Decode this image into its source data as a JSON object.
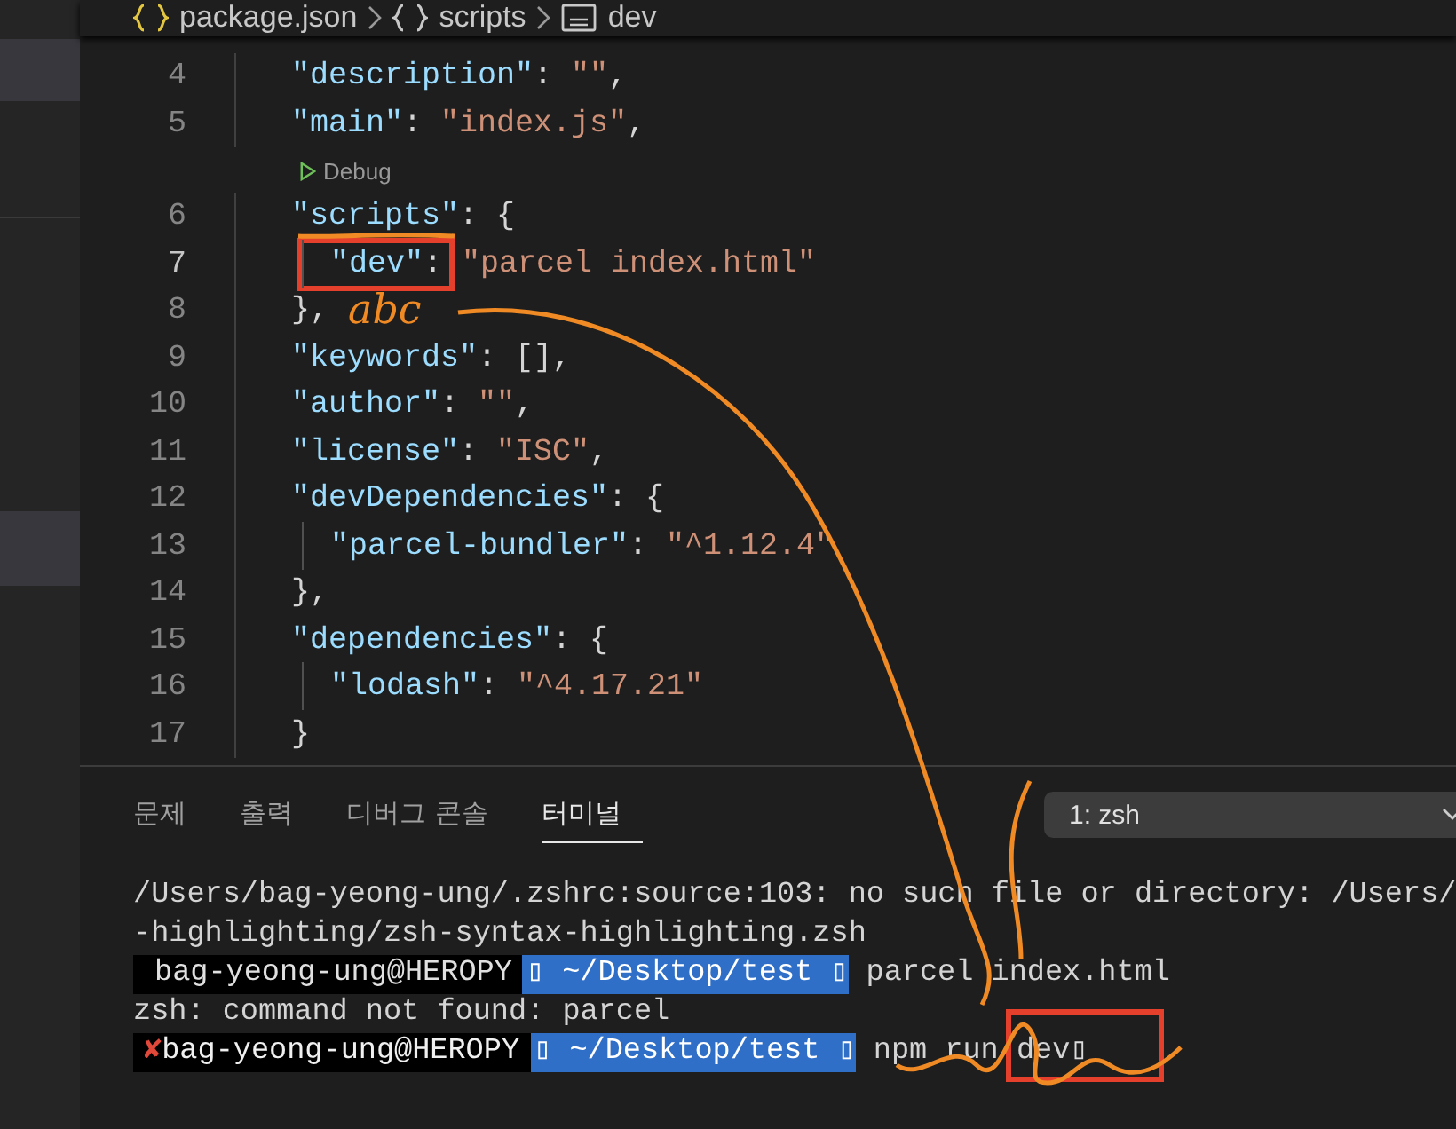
{
  "breadcrumb": [
    {
      "kind": "object",
      "label": "package.json"
    },
    {
      "kind": "object",
      "label": "scripts"
    },
    {
      "kind": "string",
      "label": "dev"
    }
  ],
  "editor": {
    "lines": [
      {
        "number": "4",
        "current": false,
        "tokens": [
          {
            "kind": "key",
            "text": "\"description\""
          },
          {
            "kind": "punct",
            "text": ": "
          },
          {
            "kind": "string",
            "text": "\"\""
          },
          {
            "kind": "punct",
            "text": ","
          }
        ]
      },
      {
        "number": "5",
        "current": false,
        "tokens": [
          {
            "kind": "key",
            "text": "\"main\""
          },
          {
            "kind": "punct",
            "text": ": "
          },
          {
            "kind": "string",
            "text": "\"index.js\""
          },
          {
            "kind": "punct",
            "text": ","
          }
        ],
        "codelens": "Debug"
      },
      {
        "number": "6",
        "current": false,
        "tokens": [
          {
            "kind": "key",
            "text": "\"scripts\""
          },
          {
            "kind": "punct",
            "text": ": {"
          }
        ],
        "children": [
          {
            "number": "7",
            "current": true,
            "tokens": [
              {
                "kind": "key",
                "text": "\"dev\"",
                "annotated": true
              },
              {
                "kind": "punct",
                "text": ":",
                "annotated": true
              },
              {
                "kind": "string",
                "text": "\"parcel index.html\""
              }
            ]
          }
        ]
      },
      {
        "number": "8",
        "current": false,
        "tokens": [
          {
            "kind": "punct",
            "text": "},"
          }
        ]
      },
      {
        "number": "9",
        "current": false,
        "tokens": [
          {
            "kind": "key",
            "text": "\"keywords\""
          },
          {
            "kind": "punct",
            "text": ": [],"
          }
        ]
      },
      {
        "number": "10",
        "current": false,
        "tokens": [
          {
            "kind": "key",
            "text": "\"author\""
          },
          {
            "kind": "punct",
            "text": ": "
          },
          {
            "kind": "string",
            "text": "\"\""
          },
          {
            "kind": "punct",
            "text": ","
          }
        ]
      },
      {
        "number": "11",
        "current": false,
        "tokens": [
          {
            "kind": "key",
            "text": "\"license\""
          },
          {
            "kind": "punct",
            "text": ": "
          },
          {
            "kind": "string",
            "text": "\"ISC\""
          },
          {
            "kind": "punct",
            "text": ","
          }
        ]
      },
      {
        "number": "12",
        "current": false,
        "tokens": [
          {
            "kind": "key",
            "text": "\"devDependencies\""
          },
          {
            "kind": "punct",
            "text": ": {"
          }
        ],
        "children": [
          {
            "number": "13",
            "current": false,
            "tokens": [
              {
                "kind": "key",
                "text": "\"parcel-bundler\""
              },
              {
                "kind": "punct",
                "text": ": "
              },
              {
                "kind": "string",
                "text": "\"^1.12.4\""
              }
            ]
          }
        ]
      },
      {
        "number": "14",
        "current": false,
        "tokens": [
          {
            "kind": "punct",
            "text": "},"
          }
        ]
      },
      {
        "number": "15",
        "current": false,
        "tokens": [
          {
            "kind": "key",
            "text": "\"dependencies\""
          },
          {
            "kind": "punct",
            "text": ": {"
          }
        ],
        "children": [
          {
            "number": "16",
            "current": false,
            "tokens": [
              {
                "kind": "key",
                "text": "\"lodash\""
              },
              {
                "kind": "punct",
                "text": ": "
              },
              {
                "kind": "string",
                "text": "\"^4.17.21\""
              }
            ]
          }
        ]
      },
      {
        "number": "17",
        "current": false,
        "tokens": [
          {
            "kind": "punct",
            "text": "}"
          }
        ]
      }
    ]
  },
  "panel": {
    "tabs": [
      {
        "label": "문제",
        "selected": false
      },
      {
        "label": "출력",
        "selected": false
      },
      {
        "label": "디버그 콘솔",
        "selected": false
      },
      {
        "label": "터미널",
        "selected": true
      }
    ],
    "terminal_select": {
      "value": "1: zsh"
    },
    "terminal": [
      {
        "kind": "output",
        "text": "/Users/bag-yeong-ung/.zshrc:source:103: no such file or directory: /Users/"
      },
      {
        "kind": "output",
        "text": "-highlighting/zsh-syntax-highlighting.zsh"
      },
      {
        "kind": "prompt",
        "failed": false,
        "user": "bag-yeong-ung@HEROPY",
        "path": "▯ ~/Desktop/test ▯",
        "command": "parcel index.html"
      },
      {
        "kind": "output",
        "text": "zsh: command not found: parcel"
      },
      {
        "kind": "prompt",
        "failed": true,
        "mark": "✘",
        "user": "bag-yeong-ung@HEROPY",
        "path": "▯ ~/Desktop/test ▯",
        "command": "npm run dev",
        "cursor": "▯"
      }
    ]
  },
  "annotation": {
    "handwriting": "abc"
  }
}
